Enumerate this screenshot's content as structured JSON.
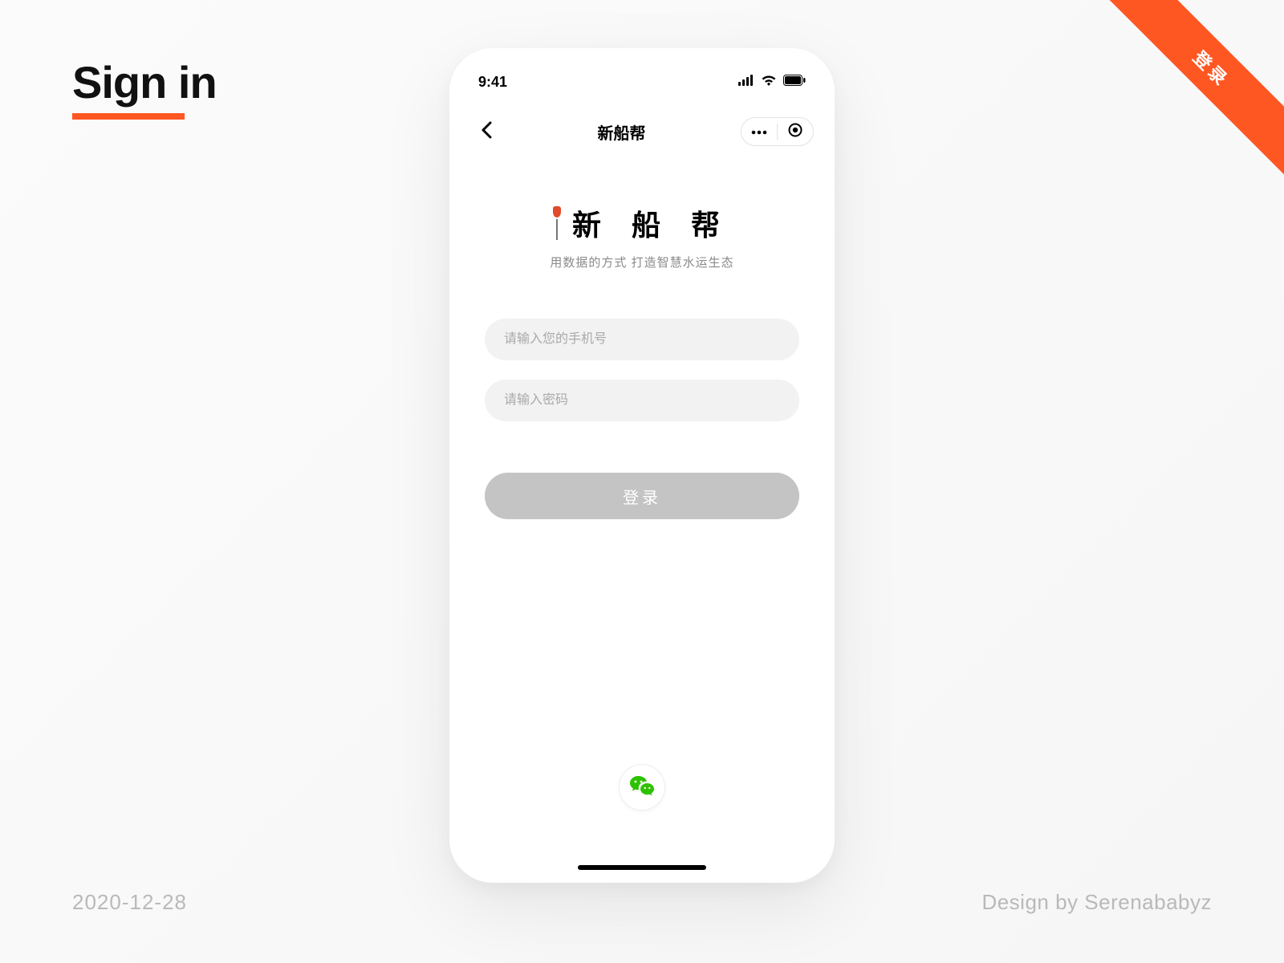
{
  "page": {
    "heading": "Sign in",
    "date": "2020-12-28",
    "credit": "Design by Serenababyz",
    "ribbon": "登录"
  },
  "status": {
    "time": "9:41"
  },
  "nav": {
    "title": "新船帮"
  },
  "brand": {
    "title": "新 船 帮",
    "subtitle": "用数据的方式 打造智慧水运生态"
  },
  "form": {
    "phone_placeholder": "请输入您的手机号",
    "password_placeholder": "请输入密码",
    "submit_label": "登录"
  },
  "colors": {
    "accent": "#ff5722",
    "wechat": "#2dc100"
  }
}
